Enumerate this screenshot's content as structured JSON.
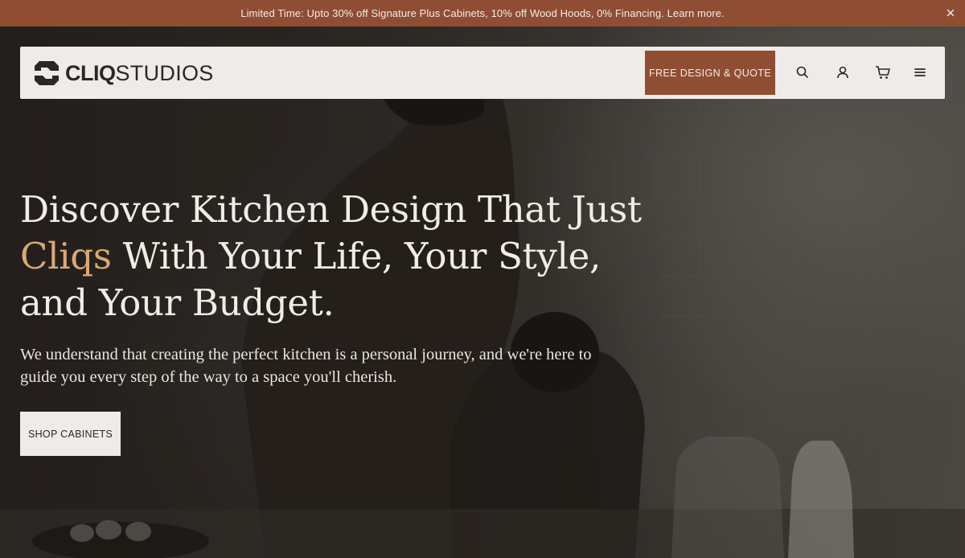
{
  "promo": {
    "text": "Limited Time: Upto 30% off Signature Plus Cabinets, 10% off Wood Hoods, 0% Financing. Learn more.",
    "close_icon": "close-icon"
  },
  "brand": {
    "name_bold": "CLIQ",
    "name_regular": "STUDIOS"
  },
  "nav": {
    "cta_label": "FREE DESIGN & QUOTE",
    "icons": [
      "search-icon",
      "account-icon",
      "cart-icon",
      "menu-icon"
    ]
  },
  "hero": {
    "headline_line1": "Discover Kitchen Design That Just",
    "headline_accent": "Cliqs",
    "headline_line2_rest": " With Your Life, Your Style,",
    "headline_line3": "and Your Budget.",
    "subcopy": "We understand that creating the perfect kitchen is a personal journey, and we're here to guide you every step of the way to a space you'll cherish.",
    "button_label": "SHOP CABINETS"
  },
  "colors": {
    "promo_bg": "#8f4e33",
    "cta_bg": "#8f4e33",
    "nav_bg": "#efebe8",
    "accent_text": "#d9a875",
    "hero_text": "#f1ece6"
  }
}
